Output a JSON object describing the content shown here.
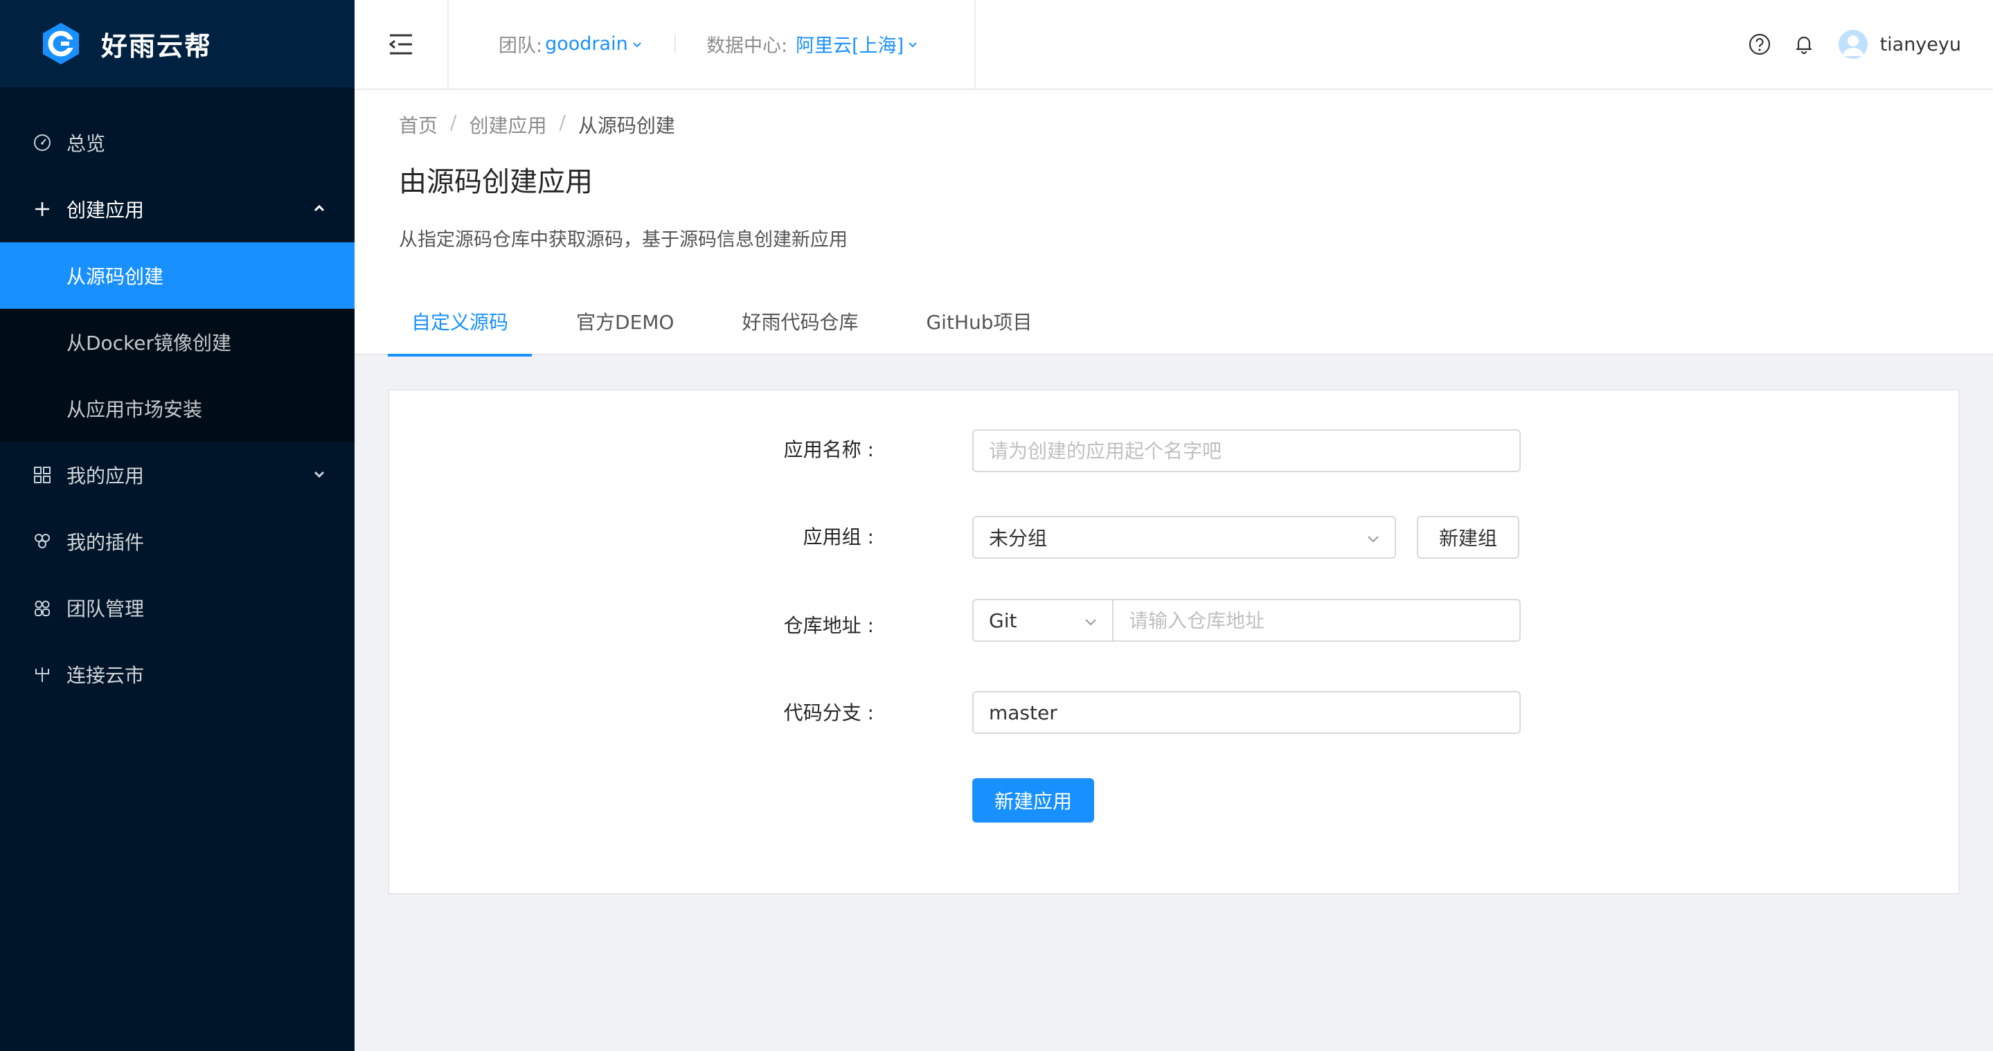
{
  "brand": {
    "name": "好雨云帮"
  },
  "sidebar": {
    "items": [
      {
        "label": "总览",
        "icon": "dashboard-icon"
      },
      {
        "label": "创建应用",
        "icon": "plus-icon",
        "expanded": true,
        "children": [
          {
            "label": "从源码创建",
            "active": true
          },
          {
            "label": "从Docker镜像创建"
          },
          {
            "label": "从应用市场安装"
          }
        ]
      },
      {
        "label": "我的应用",
        "icon": "appstore-icon"
      },
      {
        "label": "我的插件",
        "icon": "plugin-icon"
      },
      {
        "label": "团队管理",
        "icon": "team-icon"
      },
      {
        "label": "连接云市",
        "icon": "fork-icon"
      }
    ]
  },
  "header": {
    "team_label": "团队:",
    "team_value": "goodrain",
    "datacenter_label": "数据中心:",
    "datacenter_value": "阿里云[上海]",
    "username": "tianyeyu"
  },
  "page": {
    "breadcrumb": [
      "首页",
      "创建应用",
      "从源码创建"
    ],
    "title": "由源码创建应用",
    "description": "从指定源码仓库中获取源码，基于源码信息创建新应用",
    "tabs": [
      {
        "label": "自定义源码",
        "active": true
      },
      {
        "label": "官方DEMO"
      },
      {
        "label": "好雨代码仓库"
      },
      {
        "label": "GitHub项目"
      }
    ]
  },
  "form": {
    "app_name_label": "应用名称",
    "app_name_placeholder": "请为创建的应用起个名字吧",
    "app_group_label": "应用组",
    "app_group_value": "未分组",
    "new_group_button": "新建组",
    "repo_label": "仓库地址",
    "repo_type_value": "Git",
    "repo_url_placeholder": "请输入仓库地址",
    "branch_label": "代码分支",
    "branch_value": "master",
    "submit_button": "新建应用"
  },
  "colors": {
    "primary": "#1890ff",
    "sidebar_bg": "#001529",
    "logo_bg": "#002140",
    "submenu_bg": "#000c17"
  }
}
